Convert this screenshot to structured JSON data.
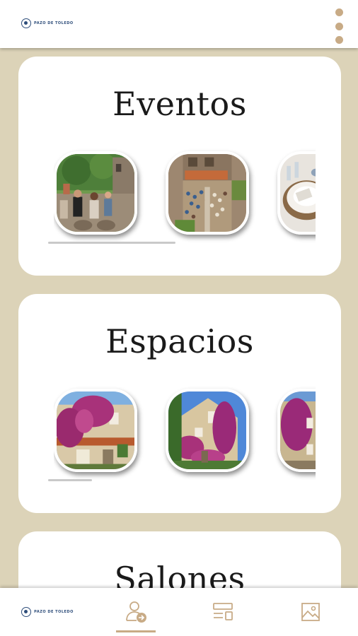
{
  "app": {
    "logo_text": "PAZO DE TOLEDO",
    "accent_color": "#c8ab86",
    "logo_color": "#2e4d7a"
  },
  "sections": [
    {
      "title": "Eventos",
      "images": [
        "garden-wedding-guests",
        "courtyard-ceremony-aerial",
        "table-setting-plates"
      ]
    },
    {
      "title": "Espacios",
      "images": [
        "manor-bougainvillea-front",
        "manor-bougainvillea-side",
        "manor-bougainvillea-wall"
      ]
    },
    {
      "title": "Salones"
    }
  ],
  "bottom_nav": {
    "items": [
      {
        "name": "home-logo",
        "icon": "logo-icon"
      },
      {
        "name": "profile",
        "icon": "user-arrow-icon",
        "active": true
      },
      {
        "name": "layout",
        "icon": "layout-list-icon"
      },
      {
        "name": "gallery",
        "icon": "image-icon"
      }
    ]
  }
}
